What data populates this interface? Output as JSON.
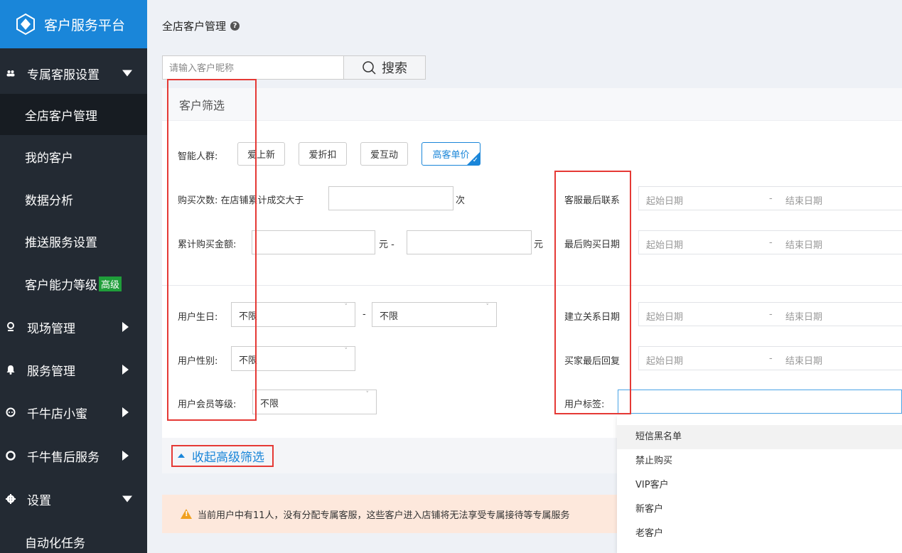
{
  "sidebar": {
    "brand": "客户服务平台",
    "items": [
      {
        "label": "专属客服设置"
      },
      {
        "label": "全店客户管理"
      },
      {
        "label": "我的客户"
      },
      {
        "label": "数据分析"
      },
      {
        "label": "推送服务设置"
      },
      {
        "label": "客户能力等级",
        "badge": "高级"
      },
      {
        "label": "现场管理"
      },
      {
        "label": "服务管理"
      },
      {
        "label": "千牛店小蜜"
      },
      {
        "label": "千牛售后服务"
      },
      {
        "label": "设置"
      },
      {
        "label": "自动化任务"
      }
    ]
  },
  "page": {
    "title": "全店客户管理",
    "help": "?"
  },
  "search": {
    "placeholder": "请输入客户昵称",
    "button": "搜索"
  },
  "filter": {
    "heading": "客户筛选",
    "crowd_label": "智能人群:",
    "crowd_tags": [
      "爱上新",
      "爱折扣",
      "爱互动",
      "高客单价"
    ],
    "purchase_count_label": "购买次数: 在店铺累计成交大于",
    "purchase_count_unit": "次",
    "amount_label": "累计购买金额:",
    "amount_unit1": "元 -",
    "amount_unit2": "元",
    "birthday_label": "用户生日:",
    "birthday_from": "不限",
    "birthday_dash": "-",
    "birthday_to": "不限",
    "gender_label": "用户性别:",
    "gender_value": "不限",
    "member_label": "用户会员等级:",
    "member_value": "不限",
    "date_rows": [
      {
        "label": "客服最后联系",
        "start": "起始日期",
        "end": "结束日期"
      },
      {
        "label": "最后购买日期",
        "start": "起始日期",
        "end": "结束日期"
      },
      {
        "label": "建立关系日期",
        "start": "起始日期",
        "end": "结束日期"
      },
      {
        "label": "买家最后回复",
        "start": "起始日期",
        "end": "结束日期"
      }
    ],
    "date_dash": "-",
    "user_tag_label": "用户标签:",
    "collapse": "收起高级筛选"
  },
  "tag_options": [
    "短信黑名单",
    "禁止购买",
    "VIP客户",
    "新客户",
    "老客户"
  ],
  "alert": "当前用户中有11人，没有分配专属客服，这些客户进入店铺将无法享受专属接待等专属服务",
  "colors": {
    "sidebar": "#232a33",
    "brand": "#1a86d9",
    "accent": "#1a86d9",
    "highlight": "#e53935",
    "alert_bg": "#fde8dc"
  }
}
